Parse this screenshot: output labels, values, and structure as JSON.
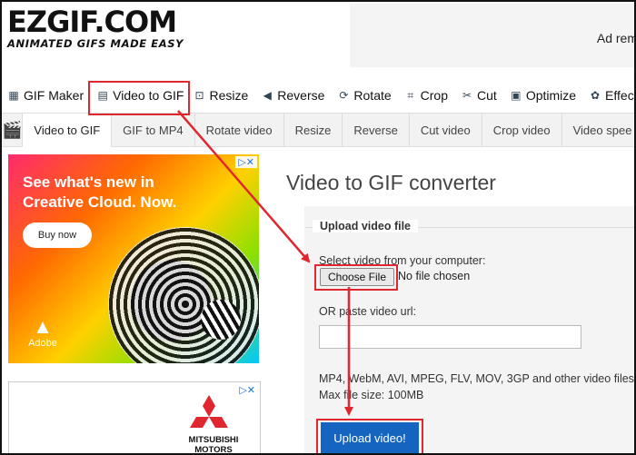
{
  "header": {
    "logo_main": "EZGIF.COM",
    "logo_tagline": "ANIMATED GIFS MADE EASY",
    "ad_text": "Ad rem"
  },
  "nav": {
    "items": [
      {
        "label": "GIF Maker",
        "icon": "gif-maker-icon"
      },
      {
        "label": "Video to GIF",
        "icon": "film-icon"
      },
      {
        "label": "Resize",
        "icon": "resize-icon"
      },
      {
        "label": "Reverse",
        "icon": "reverse-icon"
      },
      {
        "label": "Rotate",
        "icon": "rotate-icon"
      },
      {
        "label": "Crop",
        "icon": "crop-icon"
      },
      {
        "label": "Cut",
        "icon": "cut-icon"
      },
      {
        "label": "Optimize",
        "icon": "optimize-icon"
      },
      {
        "label": "Effects",
        "icon": "effects-icon"
      }
    ]
  },
  "subnav": {
    "tabs": [
      "Video to GIF",
      "GIF to MP4",
      "Rotate video",
      "Resize",
      "Reverse",
      "Cut video",
      "Crop video",
      "Video spee"
    ]
  },
  "ads": {
    "creative_cloud": {
      "headline": "See what's new in Creative Cloud. Now.",
      "button": "Buy now",
      "brand": "Adobe"
    },
    "mitsubishi": {
      "brand": "MITSUBISHI MOTORS"
    }
  },
  "converter": {
    "title": "Video to GIF converter",
    "fieldset_legend": "Upload video file",
    "select_label": "Select video from your computer:",
    "choose_file": "Choose File",
    "no_file": "No file chosen",
    "or_paste_label": "OR paste video url:",
    "url_value": "",
    "formats_text": "MP4, WebM, AVI, MPEG, FLV, MOV, 3GP and other video files",
    "max_size": "Max file size: 100MB",
    "upload_button": "Upload video!"
  },
  "colors": {
    "highlight": "#e0262e",
    "upload_button": "#1565c0"
  }
}
